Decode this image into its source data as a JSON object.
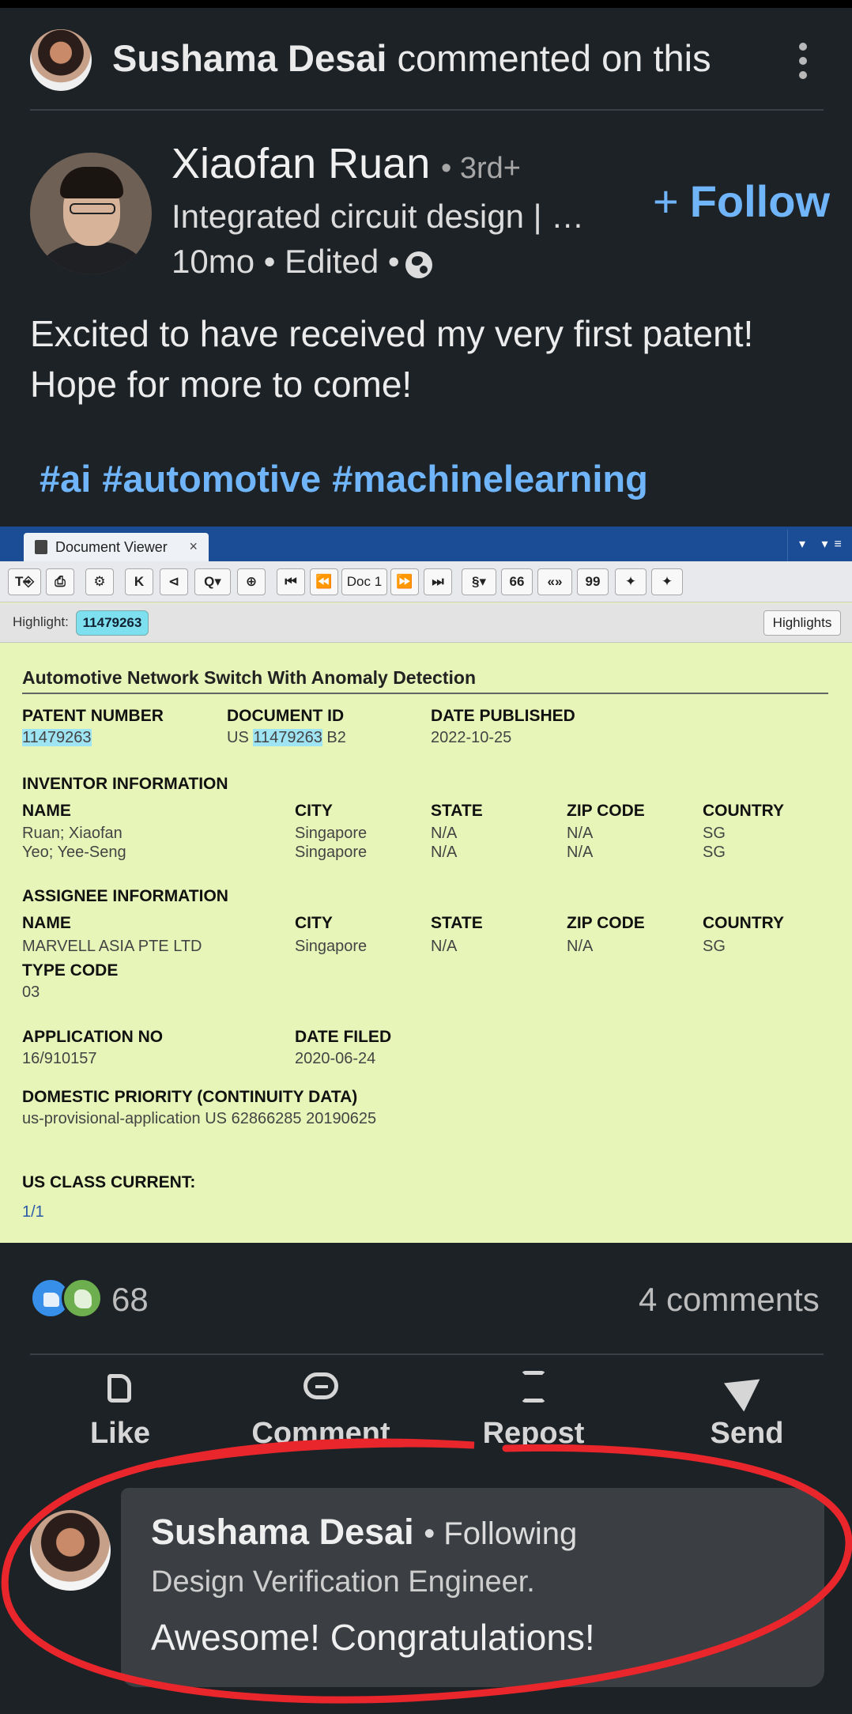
{
  "header": {
    "actor_name": "Sushama Desai",
    "action_text": "commented on this"
  },
  "author": {
    "name": "Xiaofan Ruan",
    "degree": "• 3rd+",
    "headline": "Integrated circuit design | …",
    "meta": "10mo • Edited •"
  },
  "follow": {
    "plus": "+",
    "label": "Follow"
  },
  "post": {
    "lines": [
      "Excited to have received my very first patent!",
      "Hope for more to come!"
    ],
    "hashtags": [
      "#ai",
      "#automotive",
      "#machinelearning"
    ]
  },
  "doc_viewer": {
    "tab_title": "Document Viewer",
    "tab_close": "×",
    "menu": "▾ ▾≡",
    "toolbar": [
      "T⎆",
      "⎙",
      "⚙",
      "K",
      "⊲",
      "Q▾",
      "⊕",
      "⏮",
      "⏪",
      "Doc 1",
      "⏩",
      "⏭",
      "§▾",
      "66",
      "«»",
      "99",
      "✦",
      "✦"
    ],
    "highlight_label": "Highlight:",
    "highlight_term": "11479263",
    "highlights_button": "Highlights",
    "title": "Automotive Network Switch With Anomaly Detection",
    "patent_number_label": "PATENT NUMBER",
    "patent_number": "11479263",
    "document_id_label": "DOCUMENT ID",
    "document_id_prefix": "US",
    "document_id_number": "11479263",
    "document_id_suffix": "B2",
    "date_published_label": "DATE PUBLISHED",
    "date_published": "2022-10-25",
    "inventor_heading": "INVENTOR INFORMATION",
    "assignee_heading": "ASSIGNEE INFORMATION",
    "col_name": "NAME",
    "col_city": "CITY",
    "col_state": "STATE",
    "col_zip": "ZIP CODE",
    "col_country": "COUNTRY",
    "inventors": [
      {
        "name": "Ruan; Xiaofan",
        "city": "Singapore",
        "state": "N/A",
        "zip": "N/A",
        "country": "SG"
      },
      {
        "name": "Yeo; Yee-Seng",
        "city": "Singapore",
        "state": "N/A",
        "zip": "N/A",
        "country": "SG"
      }
    ],
    "assignee": {
      "name": "MARVELL ASIA PTE LTD",
      "city": "Singapore",
      "state": "N/A",
      "zip": "N/A",
      "country": "SG"
    },
    "type_code_label": "TYPE CODE",
    "type_code": "03",
    "application_no_label": "APPLICATION NO",
    "application_no": "16/910157",
    "date_filed_label": "DATE FILED",
    "date_filed": "2020-06-24",
    "priority_label": "DOMESTIC PRIORITY (CONTINUITY DATA)",
    "priority": "us-provisional-application US 62866285 20190625",
    "us_class_label": "US CLASS CURRENT:",
    "us_class": "1/1"
  },
  "social": {
    "reaction_count": "68",
    "comment_count": "4 comments"
  },
  "actions": {
    "like": "Like",
    "comment": "Comment",
    "repost": "Repost",
    "send": "Send"
  },
  "comment": {
    "name": "Sushama Desai",
    "following": "• Following",
    "headline": "Design Verification Engineer.",
    "text": "Awesome! Congratulations!"
  },
  "colors": {
    "background": "#1d2226",
    "link": "#70b5f9",
    "annotation": "#e8262b"
  }
}
